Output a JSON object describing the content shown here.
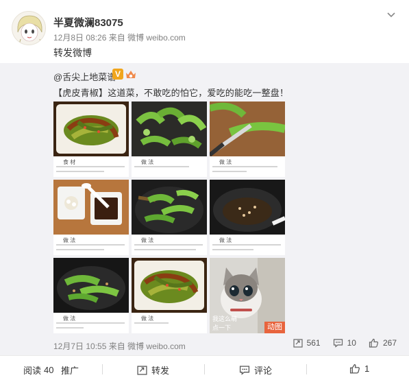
{
  "post": {
    "username": "半夏微澜83075",
    "date": "12月8日 08:26",
    "via_prefix": "来自",
    "source": "微博 weibo.com",
    "text": "转发微博"
  },
  "quoted": {
    "author": "@舌尖上地菜谱",
    "v_badge": "V",
    "text": "【虎皮青椒】这道菜，不敢吃的怕它，爱吃的能吃一整盘！",
    "images": [
      {
        "title": "食 材",
        "kind": "recipe"
      },
      {
        "title": "做 法",
        "kind": "recipe"
      },
      {
        "title": "做 法",
        "kind": "recipe"
      },
      {
        "title": "做 法",
        "kind": "recipe"
      },
      {
        "title": "做 法",
        "kind": "recipe"
      },
      {
        "title": "做 法",
        "kind": "recipe"
      },
      {
        "title": "做 法",
        "kind": "recipe"
      },
      {
        "title": "做 法",
        "kind": "recipe"
      },
      {
        "title": "",
        "kind": "gif",
        "caption_1": "我这么萌",
        "caption_2": "点一下",
        "tag": "动图"
      }
    ],
    "date": "12月7日 10:55",
    "via_prefix": "来自",
    "source": "微博 weibo.com",
    "reposts": "561",
    "comments": "10",
    "likes": "267"
  },
  "footer": {
    "reads_label": "阅读",
    "reads": "40",
    "promote": "推广",
    "repost": "转发",
    "comment": "评论",
    "like": "1"
  },
  "colors": {
    "quoted_bg": "#f2f2f5",
    "gif_tag": "#e8643d",
    "v_badge": "#f0a51d"
  }
}
